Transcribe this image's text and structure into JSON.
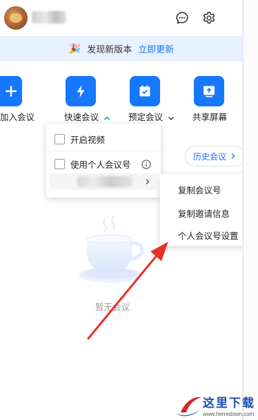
{
  "header": {
    "avatar_icon": "user-avatar",
    "chat_icon": "message-bubble-icon",
    "settings_icon": "gear-icon"
  },
  "banner": {
    "icon": "party-popper-icon",
    "text": "发现新版本",
    "link": "立即更新"
  },
  "actions": [
    {
      "label": "加入会议",
      "icon": "plus-icon"
    },
    {
      "label": "快速会议",
      "icon": "lightning-icon",
      "chevron": "up"
    },
    {
      "label": "预定会议",
      "icon": "calendar-check-icon",
      "chevron": "down"
    },
    {
      "label": "共享屏幕",
      "icon": "screen-share-icon"
    }
  ],
  "history_button": {
    "label": "历史会议",
    "icon": "chevron-right-icon"
  },
  "empty_state": {
    "label": "暂无会议",
    "icon": "coffee-cup-icon"
  },
  "quick_meeting_menu": {
    "enable_video": {
      "label": "开启视频",
      "checked": false
    },
    "use_personal_id": {
      "label": "使用个人会议号",
      "checked": false,
      "info_icon": "info-icon"
    }
  },
  "personal_id_submenu": {
    "items": [
      "复制会议号",
      "复制邀请信息",
      "个人会议号设置"
    ]
  },
  "colors": {
    "accent": "#1677ff",
    "banner_bg": "#e8f1ff",
    "annotation_arrow": "#e8302a"
  },
  "watermark": {
    "title": "这里下载",
    "url": "www.herredown.com"
  }
}
